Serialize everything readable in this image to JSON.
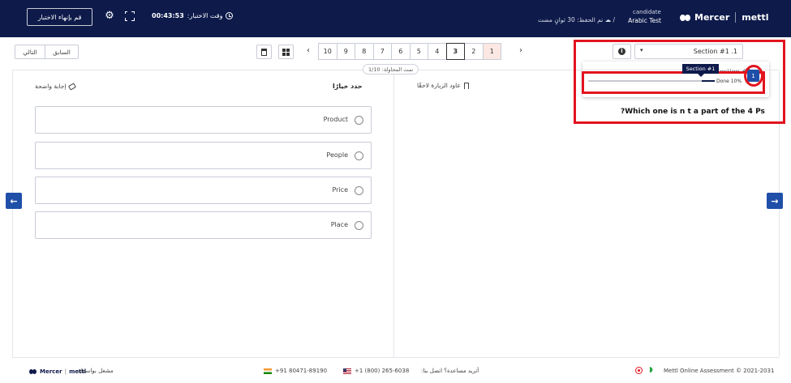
{
  "header": {
    "finish_button": "قم بإنهاء الاختبار",
    "time_label": "وقت الاختبار:",
    "time_value": "00:43:53",
    "candidate": "candidate",
    "test_name": "Arabic Test",
    "separator": "/",
    "saved_text": "تم الحفظ: 30 ثوانٍ مضت",
    "logo_brand": "Mercer",
    "logo_product": "mettl"
  },
  "toolbar": {
    "next_label": "التالي",
    "prev_label": "السابق",
    "pages": [
      "10",
      "9",
      "8",
      "7",
      "6",
      "5",
      "4",
      "3",
      "2",
      "1"
    ],
    "current_page": "3",
    "attempt_text": "تمت المحاولة: 1/10"
  },
  "section": {
    "dropdown_label": "Section #1 .1",
    "panel_title": "Section #1",
    "tooltip": "Section #1",
    "badge": "1",
    "progress_text": "Done 10%",
    "progress_fraction": 0.1
  },
  "question": {
    "text": "?Which one is n   t a part of the 4 Ps",
    "bookmark_label": "عاود الزيارة لاحقًا",
    "choose_label": "حدد خيارًا",
    "clear_label": "إجابة واضحة",
    "options": [
      "Product",
      "People",
      "Price",
      "Place"
    ]
  },
  "footer": {
    "copyright": "Mettl Online Assessment © 2021-2031",
    "help_text": "أتريد مساعدة؟ اتصل بنا:",
    "phone_us": "+1 (800) 265-6038",
    "phone_in": "+91 80471-89190",
    "powered_by": "مشغل بواسطة",
    "logo_brand": "Mercer",
    "logo_product": "mettl"
  },
  "colors": {
    "header_bg": "#0d1a4a",
    "accent_blue": "#1f4fa8",
    "highlight_red": "#e2141e",
    "answered_page_bg": "#fbe8e2"
  }
}
